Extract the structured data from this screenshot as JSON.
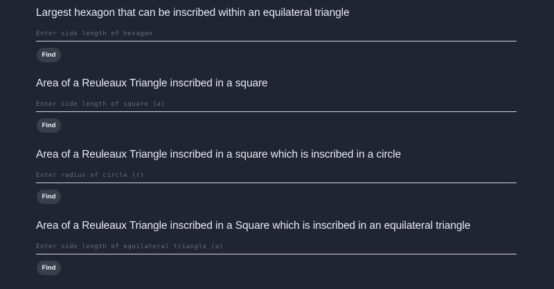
{
  "calculators": [
    {
      "title": "Largest hexagon that can be inscribed within an equilateral triangle",
      "placeholder": "Enter side length of hexagon",
      "button_label": "Find"
    },
    {
      "title": "Area of a Reuleaux Triangle inscribed in a square",
      "placeholder": "Enter side length of square (a)",
      "button_label": "Find"
    },
    {
      "title": "Area of a Reuleaux Triangle inscribed in a square which is inscribed in a circle",
      "placeholder": "Enter radius of circle (r)",
      "button_label": "Find"
    },
    {
      "title": "Area of a Reuleaux Triangle inscribed in a Square which is inscribed in an equilateral triangle",
      "placeholder": "Enter side length of equilateral triangle (a)",
      "button_label": "Find"
    }
  ]
}
